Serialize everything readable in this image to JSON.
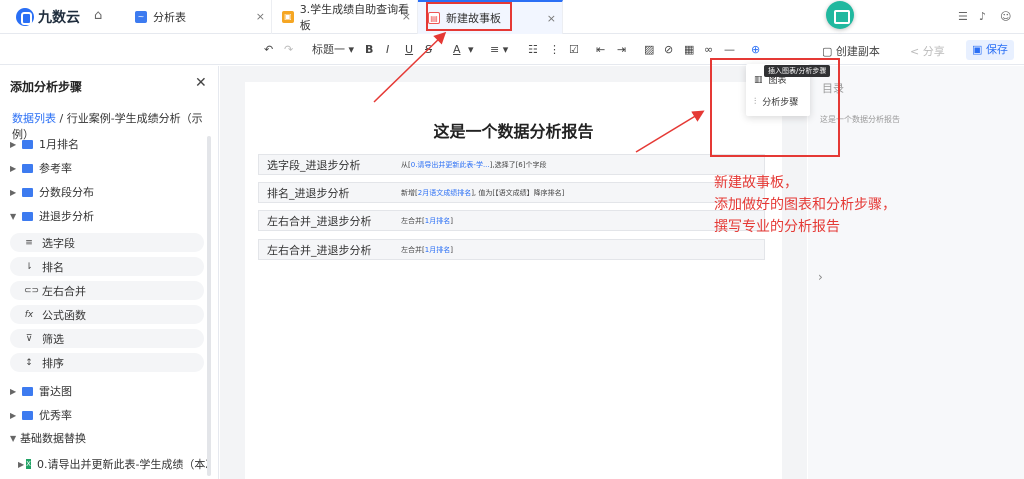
{
  "app": {
    "logo_text": "九数云"
  },
  "tabs": [
    {
      "label": "分析表",
      "close": "×"
    },
    {
      "label": "3.学生成绩自助查询看板",
      "close": "×"
    },
    {
      "label": "新建故事板",
      "close": "×"
    }
  ],
  "toolbar": {
    "heading_label": "标题一",
    "bold": "B",
    "italic": "I",
    "underline": "U",
    "strike": "S",
    "font_color": "A",
    "copy_label": "创建副本",
    "share_label": "分享",
    "save_label": "保存"
  },
  "sidebar": {
    "title": "添加分析步骤",
    "crumb_link": "数据列表",
    "crumb_text": " / 行业案例-学生成绩分析（示例）",
    "items_top": [
      {
        "label": "1月排名"
      },
      {
        "label": "参考率"
      },
      {
        "label": "分数段分布"
      },
      {
        "label": "进退步分析"
      }
    ],
    "sub_items": [
      {
        "icon": "≡",
        "label": "选字段"
      },
      {
        "icon": "⇂",
        "label": "排名"
      },
      {
        "icon": "⊂⊃",
        "label": "左右合并"
      },
      {
        "icon": "fx",
        "label": "公式函数"
      },
      {
        "icon": "⊽",
        "label": "筛选"
      },
      {
        "icon": "↕",
        "label": "排序"
      }
    ],
    "items_bottom": [
      {
        "label": "雷达图"
      },
      {
        "label": "优秀率"
      },
      {
        "label": "基础数据替换"
      }
    ],
    "last_item": "0.请导出并更新此表-学生成绩（本次..."
  },
  "document": {
    "title": "这是一个数据分析报告",
    "rows": [
      {
        "name": "选字段_进退步分析",
        "desc_pre": "从[",
        "desc_link": "0.请导出并更新此表-学...",
        "desc_post": "],选择了[6]个字段"
      },
      {
        "name": "排名_进退步分析",
        "desc_pre": "新增[",
        "desc_link": "2月语文成绩排名",
        "desc_post": "], 值为[【语文成绩】降序排名]"
      },
      {
        "name": "左右合并_进退步分析",
        "desc_pre": "左合并[",
        "desc_link": "1月排名",
        "desc_post": "]"
      },
      {
        "name": "左右合并_进退步分析",
        "desc_pre": "左合并[",
        "desc_link": "1月排名",
        "desc_post": "]"
      }
    ]
  },
  "right_panel": {
    "title": "目录",
    "toc_item": "这是一个数据分析报告"
  },
  "insert_menu": {
    "tooltip": "插入图表/分析步骤",
    "items": [
      {
        "label": "图表"
      },
      {
        "label": "分析步骤"
      }
    ]
  },
  "annotation": {
    "text": "新建故事板，\n添加做好的图表和分析步骤，\n撰写专业的分析报告"
  },
  "colors": {
    "accent": "#2a6ff5",
    "annotation": "#e53935",
    "fab": "#21b89f"
  }
}
